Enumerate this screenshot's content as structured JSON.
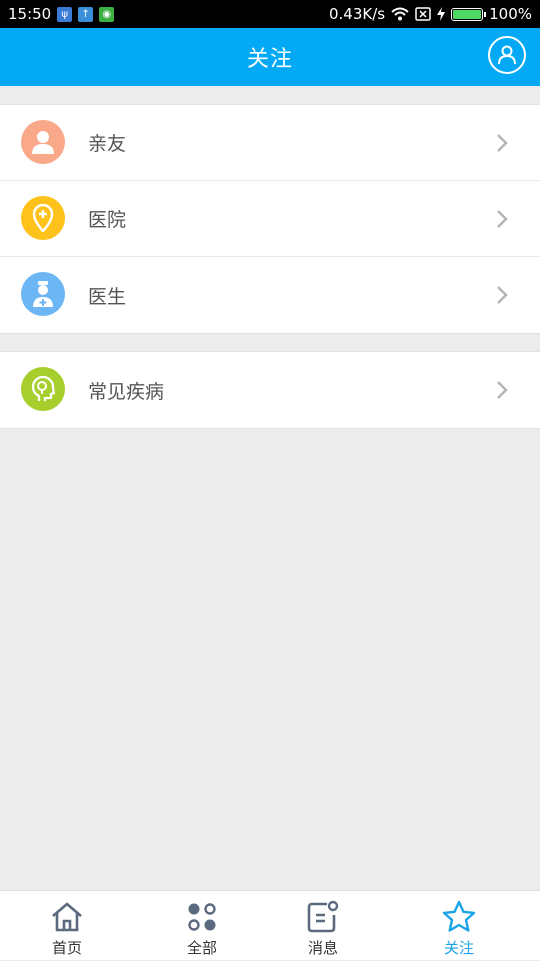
{
  "status_bar": {
    "time": "15:50",
    "network_speed": "0.43K/s",
    "battery_percent": "100%",
    "battery_level": 1.0
  },
  "header": {
    "title": "关注"
  },
  "groups": [
    {
      "items": [
        {
          "label": "亲友",
          "icon": "person-icon",
          "color": "#f9a98a"
        },
        {
          "label": "医院",
          "icon": "hospital-location-icon",
          "color": "#ffc21a"
        },
        {
          "label": "医生",
          "icon": "doctor-icon",
          "color": "#6cb6f5"
        }
      ]
    },
    {
      "items": [
        {
          "label": "常见疾病",
          "icon": "head-brain-icon",
          "color": "#a6cf2d"
        }
      ]
    }
  ],
  "tab_bar": {
    "tabs": [
      {
        "label": "首页",
        "icon": "home-icon",
        "active": false
      },
      {
        "label": "全部",
        "icon": "grid-dots-icon",
        "active": false
      },
      {
        "label": "消息",
        "icon": "message-icon",
        "active": false
      },
      {
        "label": "关注",
        "icon": "star-icon",
        "active": true
      }
    ],
    "active_color": "#1aa3e6",
    "inactive_color": "#5c6a80"
  },
  "colors": {
    "header_bg": "#03a9f4",
    "page_bg": "#ececec"
  }
}
